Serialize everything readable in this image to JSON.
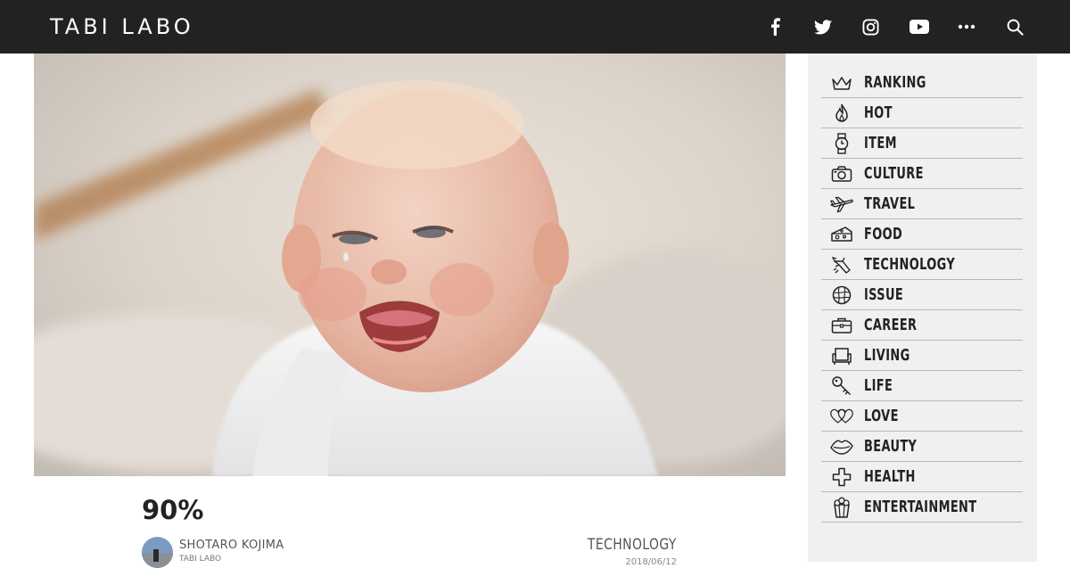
{
  "header": {
    "logo": "TABI LABO",
    "icons": [
      "facebook-icon",
      "twitter-icon",
      "instagram-icon",
      "youtube-icon",
      "more-icon",
      "search-icon"
    ],
    "background": "#222222"
  },
  "article": {
    "title": "90%",
    "author_name": "SHOTARO KOJIMA",
    "author_org": "TABI LABO",
    "category": "TECHNOLOGY",
    "date": "2018/06/12"
  },
  "sidebar": {
    "items": [
      {
        "label": "RANKING",
        "icon": "crown-icon"
      },
      {
        "label": "HOT",
        "icon": "flame-icon"
      },
      {
        "label": "ITEM",
        "icon": "watch-icon"
      },
      {
        "label": "CULTURE",
        "icon": "camera-icon"
      },
      {
        "label": "TRAVEL",
        "icon": "airplane-icon"
      },
      {
        "label": "FOOD",
        "icon": "cheese-icon"
      },
      {
        "label": "TECHNOLOGY",
        "icon": "rocket-icon"
      },
      {
        "label": "ISSUE",
        "icon": "globe-icon"
      },
      {
        "label": "CAREER",
        "icon": "briefcase-icon"
      },
      {
        "label": "LIVING",
        "icon": "armchair-icon"
      },
      {
        "label": "LIFE",
        "icon": "key-icon"
      },
      {
        "label": "LOVE",
        "icon": "heart-icon"
      },
      {
        "label": "BEAUTY",
        "icon": "lips-icon"
      },
      {
        "label": "HEALTH",
        "icon": "cross-icon"
      },
      {
        "label": "ENTERTAINMENT",
        "icon": "popcorn-icon"
      }
    ]
  }
}
